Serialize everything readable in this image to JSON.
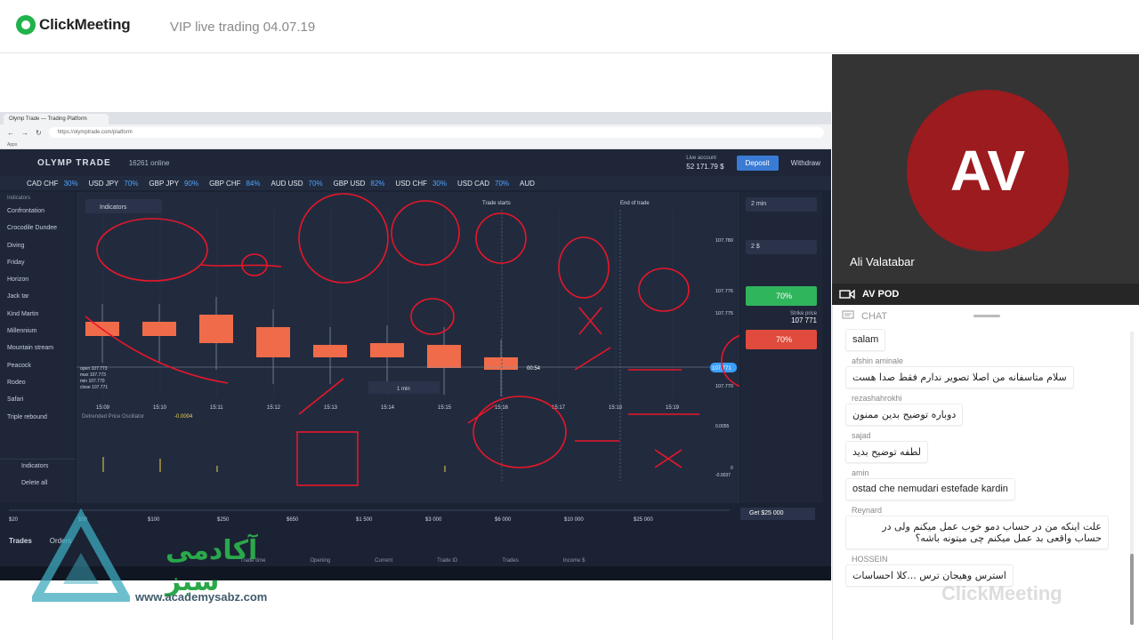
{
  "app": {
    "brand": "ClickMeeting",
    "meeting_title": "VIP live trading 04.07.19"
  },
  "browser": {
    "tab_title": "Olymp Trade — Trading Platform",
    "url": "https://olymptrade.com/platform",
    "apps_label": "Apps"
  },
  "platform": {
    "brand": "OLYMP TRADE",
    "online": "16261 online",
    "live_account_label": "Live account",
    "balance": "52 171.79 $",
    "deposit": "Deposit",
    "withdraw": "Withdraw",
    "assets": [
      {
        "name": "CAD CHF",
        "pct": "30%"
      },
      {
        "name": "USD JPY",
        "pct": "70%"
      },
      {
        "name": "GBP JPY",
        "pct": "90%"
      },
      {
        "name": "GBP CHF",
        "pct": "84%"
      },
      {
        "name": "AUD USD",
        "pct": "70%"
      },
      {
        "name": "GBP USD",
        "pct": "82%"
      },
      {
        "name": "USD CHF",
        "pct": "30%"
      },
      {
        "name": "USD CAD",
        "pct": "70%"
      },
      {
        "name": "AUD",
        "pct": ""
      }
    ],
    "indicators_label": "Indicators",
    "sidebar_items": [
      "Confrontation",
      "Crocodile Dundee",
      "Diving",
      "Friday",
      "Horizon",
      "Jack tar",
      "Kind Martin",
      "Millennium",
      "Mountain stream",
      "Peacock",
      "Rodeo",
      "Safari",
      "Triple rebound"
    ],
    "sidebar_bottom": [
      "Indicators",
      "Delete all"
    ],
    "trade_starts": "Trade starts",
    "end_of_trade": "End of trade",
    "time_labels": [
      "15:09",
      "15:10",
      "15:11",
      "15:12",
      "15:13",
      "15:14",
      "15:15",
      "15:16",
      "15:17",
      "15:18",
      "15:19"
    ],
    "price_labels": [
      "107.780",
      "107.776",
      "107.775",
      "107.771",
      "107.770"
    ],
    "timeframe": "1 min",
    "countdown": "00:54",
    "oscillator_label": "Detrended Price Oscillator",
    "oscillator_value": "-0.0004",
    "osc_scale": [
      "0.0055",
      "0",
      "-0.0037"
    ],
    "duration": "2 min",
    "amount": "2 $",
    "up_pct": "70%",
    "down_pct": "70%",
    "strike_label": "Strike price",
    "strike_value": "107 771",
    "amount_scale": [
      "$20",
      "$50",
      "$100",
      "$250",
      "$650",
      "$1 500",
      "$3 000",
      "$6 000",
      "$10 000",
      "$25 000"
    ],
    "get_label": "Get $25 000",
    "bottom_tabs": [
      "Trades",
      "Orders"
    ],
    "trade_history_cols": [
      "Trade time",
      "Opening",
      "Current",
      "Trade ID",
      "Trades",
      "Income $"
    ],
    "candle_info": [
      "open 107.773",
      "max 107.773",
      "min 107.770",
      "close 107.771"
    ]
  },
  "watermark": {
    "brand_fa": "آکادمی سبز",
    "url": "www.academysabz.com"
  },
  "video": {
    "initials": "AV",
    "presenter": "Ali Valatabar",
    "pod_label": "AV POD"
  },
  "chat": {
    "title": "CHAT",
    "messages": [
      {
        "author": "",
        "text": "salam"
      },
      {
        "author": "afshin aminale",
        "text": "سلام متاسفانه من اصلا تصویر ندارم فقط صدا هست"
      },
      {
        "author": "rezashahrokhi",
        "text": "دوباره توضیح بدین ممنون"
      },
      {
        "author": "sajad",
        "text": "لطفه توضیح بدید"
      },
      {
        "author": "amin",
        "text": "ostad che nemudari estefade kardin"
      },
      {
        "author": "Reynard",
        "text": "علت اینکه من در حساب دمو خوب عمل میکنم ولی در حساب واقعی بد عمل میکنم چی میتونه باشه؟"
      },
      {
        "author": "HOSSEIN",
        "text": "استرس وهیجان ترس ...کلا احساسات"
      }
    ],
    "watermark": "ClickMeeting"
  },
  "colors": {
    "brand_green": "#21b24b",
    "avatar_bg": "#9b1b1e",
    "up": "#2fb55b",
    "down": "#e04b3d",
    "candle": "#ef6b4a",
    "annotation": "#e8162a"
  }
}
